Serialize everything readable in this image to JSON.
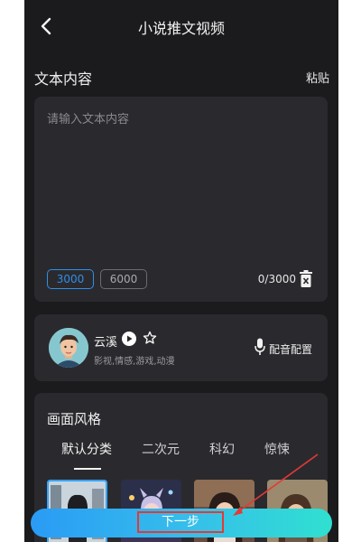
{
  "header": {
    "title": "小说推文视频",
    "back_icon": "chevron-left-icon"
  },
  "text_section": {
    "label": "文本内容",
    "paste_label": "粘贴",
    "placeholder": "请输入文本内容",
    "value": "",
    "length_options": [
      "3000",
      "6000"
    ],
    "selected_length": "3000",
    "counter": "0/3000",
    "clear_icon": "trash-icon"
  },
  "voice": {
    "name": "云溪",
    "tags": "影视,情感,游戏,动漫",
    "play_icon": "play-icon",
    "favorite_icon": "star-icon",
    "dubbing_label": "配音配置",
    "dubbing_icon": "mic-icon"
  },
  "style_section": {
    "label": "画面风格",
    "tabs": [
      "默认分类",
      "二次元",
      "科幻",
      "惊悚"
    ],
    "active_tab": "默认分类"
  },
  "footer": {
    "next_label": "下一步"
  },
  "colors": {
    "accent": "#2f8fe8",
    "background": "#1b1b1d",
    "card": "#2a2a2e",
    "annotation": "#e53935"
  }
}
